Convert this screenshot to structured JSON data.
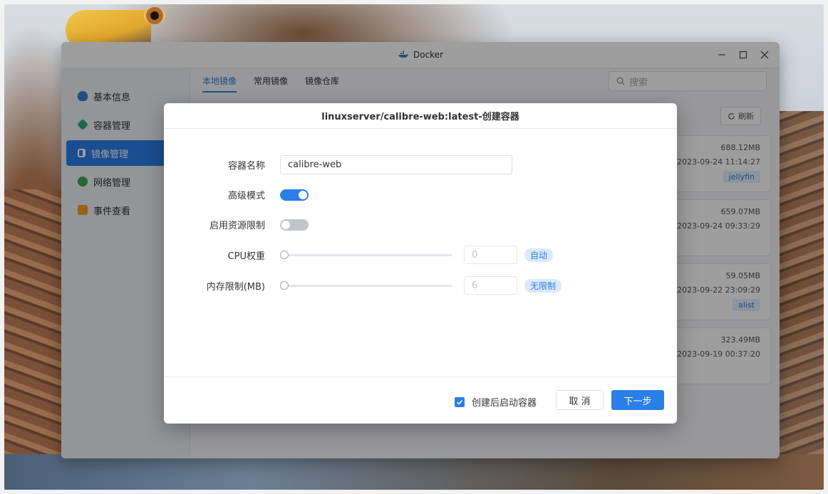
{
  "window": {
    "title": "Docker"
  },
  "sidebar": {
    "items": [
      {
        "label": "基本信息",
        "icon": "whale-icon",
        "active": false
      },
      {
        "label": "容器管理",
        "icon": "cube-icon",
        "active": false
      },
      {
        "label": "镜像管理",
        "icon": "image-icon",
        "active": true
      },
      {
        "label": "网络管理",
        "icon": "globe-icon",
        "active": false
      },
      {
        "label": "事件查看",
        "icon": "calendar-icon",
        "active": false
      }
    ]
  },
  "tabs": [
    {
      "label": "本地镜像",
      "active": true
    },
    {
      "label": "常用镜像",
      "active": false
    },
    {
      "label": "镜像仓库",
      "active": false
    }
  ],
  "search": {
    "placeholder": "搜索"
  },
  "toolbar": {
    "refresh_label": "刷新"
  },
  "images": [
    {
      "size": "688.12MB",
      "date": "2023-09-24 11:14:27",
      "tag": "jellyfin"
    },
    {
      "size": "659.07MB",
      "date": "2023-09-24 09:33:29",
      "tag": ""
    },
    {
      "size": "59.05MB",
      "date": "2023-09-22 23:09:29",
      "tag": "alist"
    },
    {
      "size": "323.49MB",
      "date": "2023-09-19 00:37:20",
      "tag": ""
    }
  ],
  "dialog": {
    "title": "linuxserver/calibre-web:latest-创建容器",
    "fields": {
      "name_label": "容器名称",
      "name_value": "calibre-web",
      "advanced_label": "高级模式",
      "advanced_on": true,
      "limit_label": "启用资源限制",
      "limit_on": false,
      "cpu_label": "CPU权重",
      "cpu_value": "0",
      "cpu_badge": "自动",
      "mem_label": "内存限制(MB)",
      "mem_value": "6",
      "mem_badge": "无限制"
    },
    "footer": {
      "autostart_label": "创建后启动容器",
      "autostart_checked": true,
      "cancel_label": "取 消",
      "next_label": "下一步"
    }
  },
  "colors": {
    "accent": "#2b7fe8",
    "overlay": "rgba(0,0,0,0.38)"
  }
}
